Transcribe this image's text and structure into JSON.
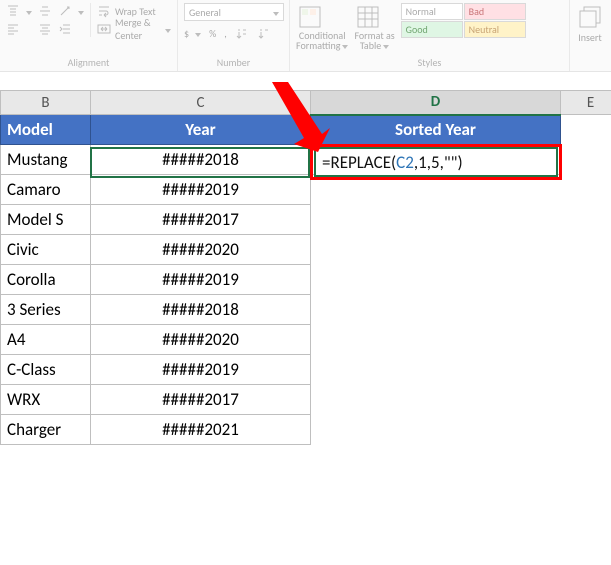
{
  "ribbon": {
    "wrap_text": "Wrap Text",
    "merge_center": "Merge & Center",
    "alignment_label": "Alignment",
    "number_format": "General",
    "number_label": "Number",
    "cond_fmt": "Conditional",
    "cond_fmt2": "Formatting",
    "fmt_table": "Format as",
    "fmt_table2": "Table",
    "styles_label": "Styles",
    "style_normal": "Normal",
    "style_bad": "Bad",
    "style_good": "Good",
    "style_neutral": "Neutral",
    "insert": "Insert"
  },
  "columns": {
    "b": "B",
    "c": "C",
    "d": "D",
    "e": "E"
  },
  "headers": {
    "model": "Model",
    "year": "Year",
    "sorted_year": "Sorted Year"
  },
  "formula": {
    "prefix": "=REPLACE(",
    "ref": "C2",
    "suffix": ",1,5,\"\")"
  },
  "rows": [
    {
      "model": "Mustang",
      "year": "#####2018"
    },
    {
      "model": "Camaro",
      "year": "#####2019"
    },
    {
      "model": "Model S",
      "year": "#####2017"
    },
    {
      "model": "Civic",
      "year": "#####2020"
    },
    {
      "model": "Corolla",
      "year": "#####2019"
    },
    {
      "model": "3 Series",
      "year": "#####2018"
    },
    {
      "model": "A4",
      "year": "#####2020"
    },
    {
      "model": "C-Class",
      "year": "#####2019"
    },
    {
      "model": "WRX",
      "year": "#####2017"
    },
    {
      "model": "Charger",
      "year": "#####2021"
    }
  ]
}
